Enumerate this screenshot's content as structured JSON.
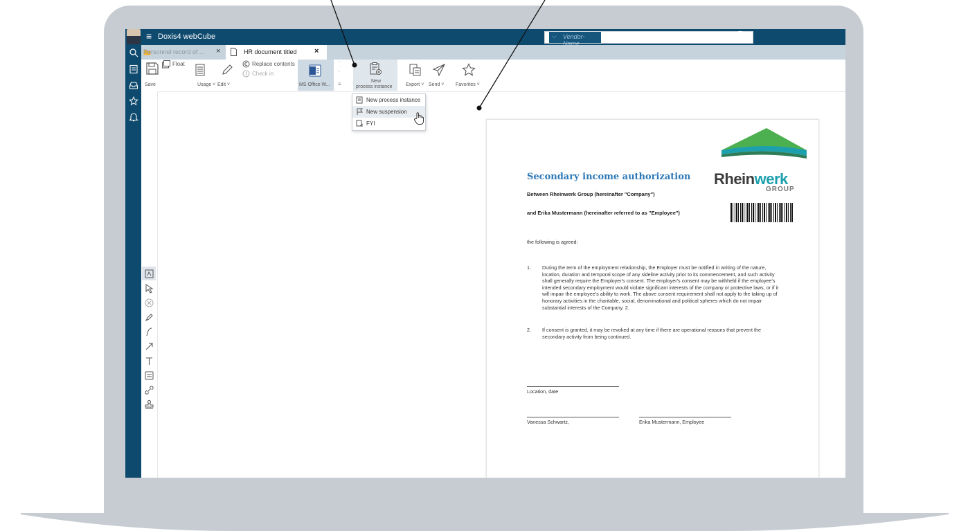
{
  "app": {
    "title": "Doxis4 webCube",
    "menu_glyph": "≡"
  },
  "search": {
    "placeholder": "Vendor-Name",
    "dropdown_glyph": "⌵"
  },
  "tabs": [
    {
      "label": "Personnel record of ...",
      "close": "×"
    },
    {
      "label": "HR document titled",
      "close": "×"
    }
  ],
  "ribbon": {
    "save": "Save",
    "float": "Float",
    "usage": "Usage ˅",
    "edit": "Edit ˅",
    "replace_contents": "Replace contents",
    "check_in": "Check in",
    "ms_office": "MS Office W...",
    "new_process_line1": "New",
    "new_process_line2": "process instance",
    "export": "Export ˅",
    "send": "Send ˅",
    "favorites": "Favorites ˅"
  },
  "dropdown": [
    {
      "label": "New process instance"
    },
    {
      "label": "New suspension"
    },
    {
      "label": "FYI"
    }
  ],
  "document": {
    "title": "Secondary income authorization",
    "between": "Between Rheinwerk Group (hereinafter \"Company\")",
    "and": "and Erika Mustermann (hereinafter referred to as \"Employee\")",
    "agreed": "the following is agreed:",
    "items": [
      {
        "num": "1.",
        "text": "During the term of the employment relationship, the Employer must be notified in writing of the nature, location, duration and temporal scope of any sideline activity prior to its commencement, and such activity shall generally require the Employer's consent. The employer's consent may be withheld if the employee's intended secondary employment would violate significant interests of the company or protective laws, or if it will impair the employee's ability to work. The above consent requirement shall not apply to the taking up of honorary activities in the charitable, social, denominational and political spheres which do not impair substantial interests of the Company. 2."
      },
      {
        "num": "2.",
        "text": "If consent is granted, it may be revoked at any time if there are operational reasons that prevent the secondary activity from being continued."
      }
    ],
    "location_date": "Location, date",
    "signer1": "Vanessa Schwartz,",
    "signer2": "Erika Mustermann, Employee",
    "logo_main": "Rhein",
    "logo_accent": "werk",
    "logo_sub": "GROUP"
  },
  "colors": {
    "titlebar": "#0e4a6e",
    "accent": "#2e78b7",
    "logo_teal": "#1ca0ad",
    "logo_green": "#4caf50",
    "frame": "#c6ccd1"
  }
}
